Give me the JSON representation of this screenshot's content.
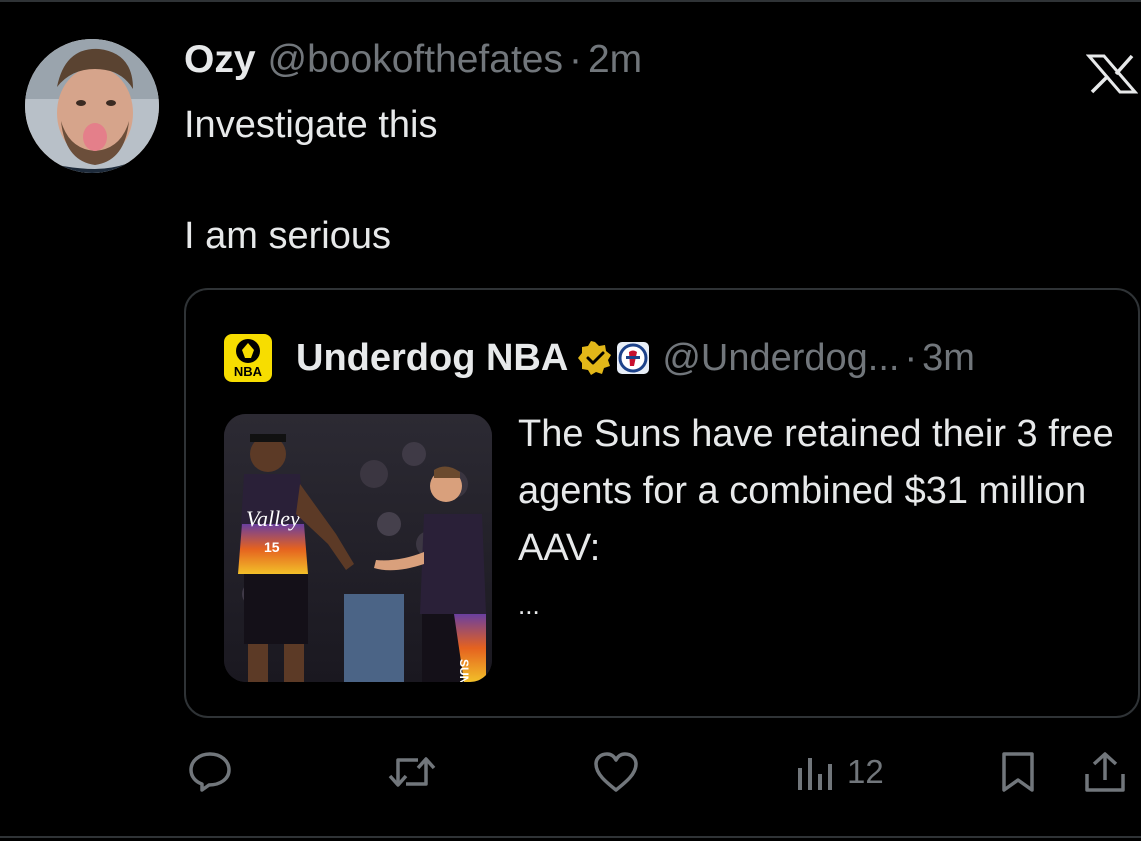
{
  "tweet": {
    "author_name": "Ozy",
    "author_handle": "@bookofthefates",
    "separator": "·",
    "time": "2m",
    "text_line1": "Investigate this",
    "text_line2": "I am serious"
  },
  "quote": {
    "logo_text": "NBA",
    "author_name": "Underdog NBA",
    "author_handle": "@Underdog...",
    "separator": "·",
    "time": "3m",
    "text": "The Suns have retained their 3 free agents for a combined $31 million AAV:",
    "ellipsis": "...",
    "image_jersey_text": "Valley",
    "image_jersey_number": "15",
    "image_shorts_text": "SUNS"
  },
  "actions": {
    "views": "12"
  },
  "colors": {
    "background": "#000000",
    "text": "#e7e9ea",
    "secondary": "#71767b",
    "border": "#2f3336",
    "verified_gold": "#e2b719",
    "logo_yellow": "#f7dd00"
  },
  "icons": {
    "x_logo": "x-logo-icon",
    "reply": "reply-icon",
    "retweet": "retweet-icon",
    "like": "heart-icon",
    "views": "views-icon",
    "bookmark": "bookmark-icon",
    "share": "share-icon",
    "verified": "verified-gold-badge-icon",
    "affiliate": "affiliate-badge-icon"
  }
}
